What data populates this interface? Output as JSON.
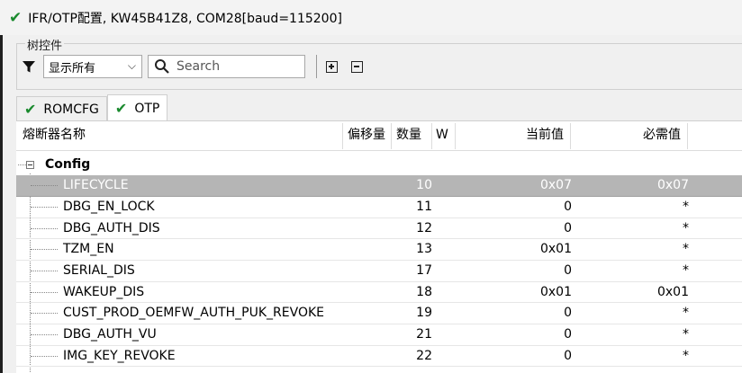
{
  "window": {
    "title": "IFR/OTP配置, KW45B41Z8, COM28[baud=115200]"
  },
  "toolbar": {
    "group_label": "树控件",
    "filter_value": "显示所有",
    "search_placeholder": "Search"
  },
  "tabs": [
    {
      "label": "ROMCFG",
      "active": false
    },
    {
      "label": "OTP",
      "active": true
    }
  ],
  "table": {
    "columns": {
      "name": "熔断器名称",
      "offset": "偏移量",
      "count": "数量",
      "w": "W",
      "current": "当前值",
      "required": "必需值"
    },
    "group": "Config",
    "rows": [
      {
        "name": "LIFECYCLE",
        "count": "10",
        "current": "0x07",
        "required": "0x07",
        "selected": true
      },
      {
        "name": "DBG_EN_LOCK",
        "count": "11",
        "current": "0",
        "required": "*"
      },
      {
        "name": "DBG_AUTH_DIS",
        "count": "12",
        "current": "0",
        "required": "*"
      },
      {
        "name": "TZM_EN",
        "count": "13",
        "current": "0x01",
        "required": "*"
      },
      {
        "name": "SERIAL_DIS",
        "count": "17",
        "current": "0",
        "required": "*"
      },
      {
        "name": "WAKEUP_DIS",
        "count": "18",
        "current": "0x01",
        "required": "0x01"
      },
      {
        "name": "CUST_PROD_OEMFW_AUTH_PUK_REVOKE",
        "count": "19",
        "current": "0",
        "required": "*"
      },
      {
        "name": "DBG_AUTH_VU",
        "count": "21",
        "current": "0",
        "required": "*"
      },
      {
        "name": "IMG_KEY_REVOKE",
        "count": "22",
        "current": "0",
        "required": "*"
      }
    ]
  }
}
